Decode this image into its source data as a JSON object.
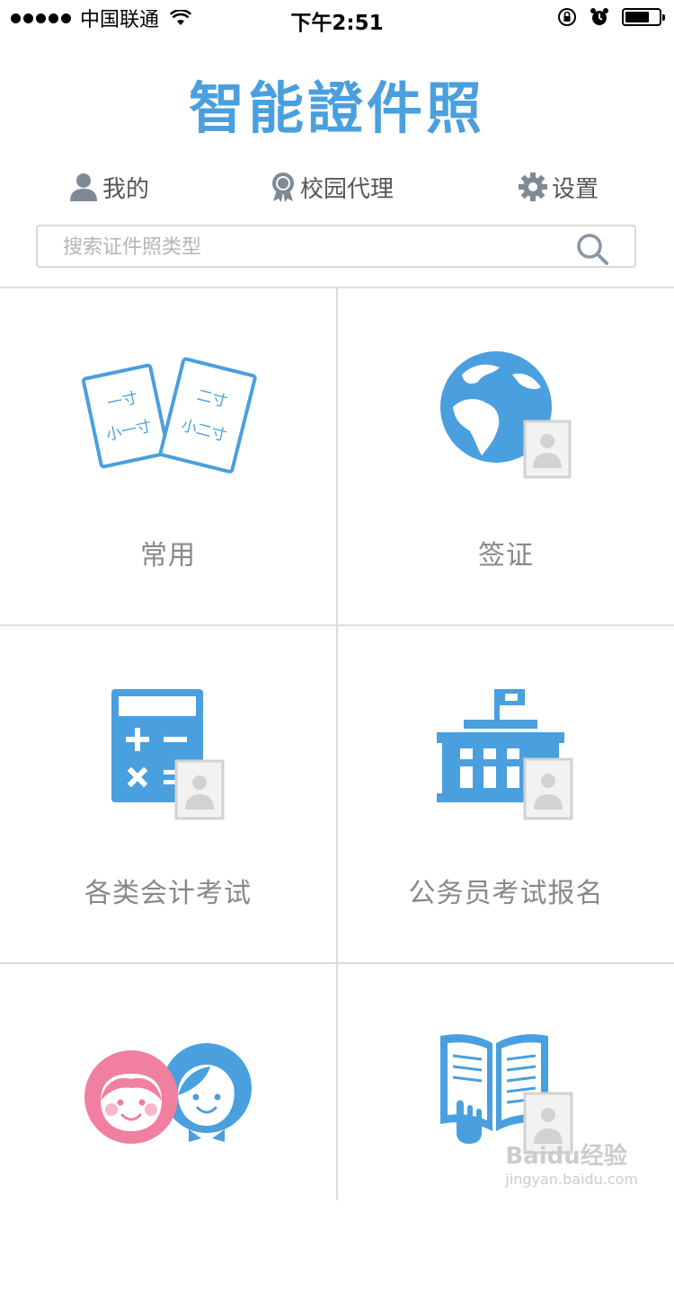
{
  "status_bar": {
    "carrier": "中国联通",
    "time": "下午2:51"
  },
  "app": {
    "title": "智能證件照"
  },
  "nav": {
    "mine": "我的",
    "campus_agent": "校园代理",
    "settings": "设置"
  },
  "search": {
    "placeholder": "搜索证件照类型"
  },
  "icon_labels": {
    "one_inch": "一寸",
    "two_inch": "二寸",
    "small_one_inch": "小一寸",
    "small_two_inch": "小二寸"
  },
  "categories": [
    {
      "label": "常用",
      "icon": "photo-cards-icon"
    },
    {
      "label": "签证",
      "icon": "globe-photo-icon"
    },
    {
      "label": "各类会计考试",
      "icon": "calculator-photo-icon"
    },
    {
      "label": "公务员考试报名",
      "icon": "government-building-icon"
    },
    {
      "label": "",
      "icon": "children-faces-icon"
    },
    {
      "label": "",
      "icon": "open-book-icon"
    }
  ],
  "watermark": {
    "brand": "Baidu经验",
    "url": "jingyan.baidu.com"
  },
  "colors": {
    "accent": "#4a9fde",
    "pink": "#f07fa0",
    "grid_line": "#dcdcdc",
    "label_gray": "#888888"
  }
}
